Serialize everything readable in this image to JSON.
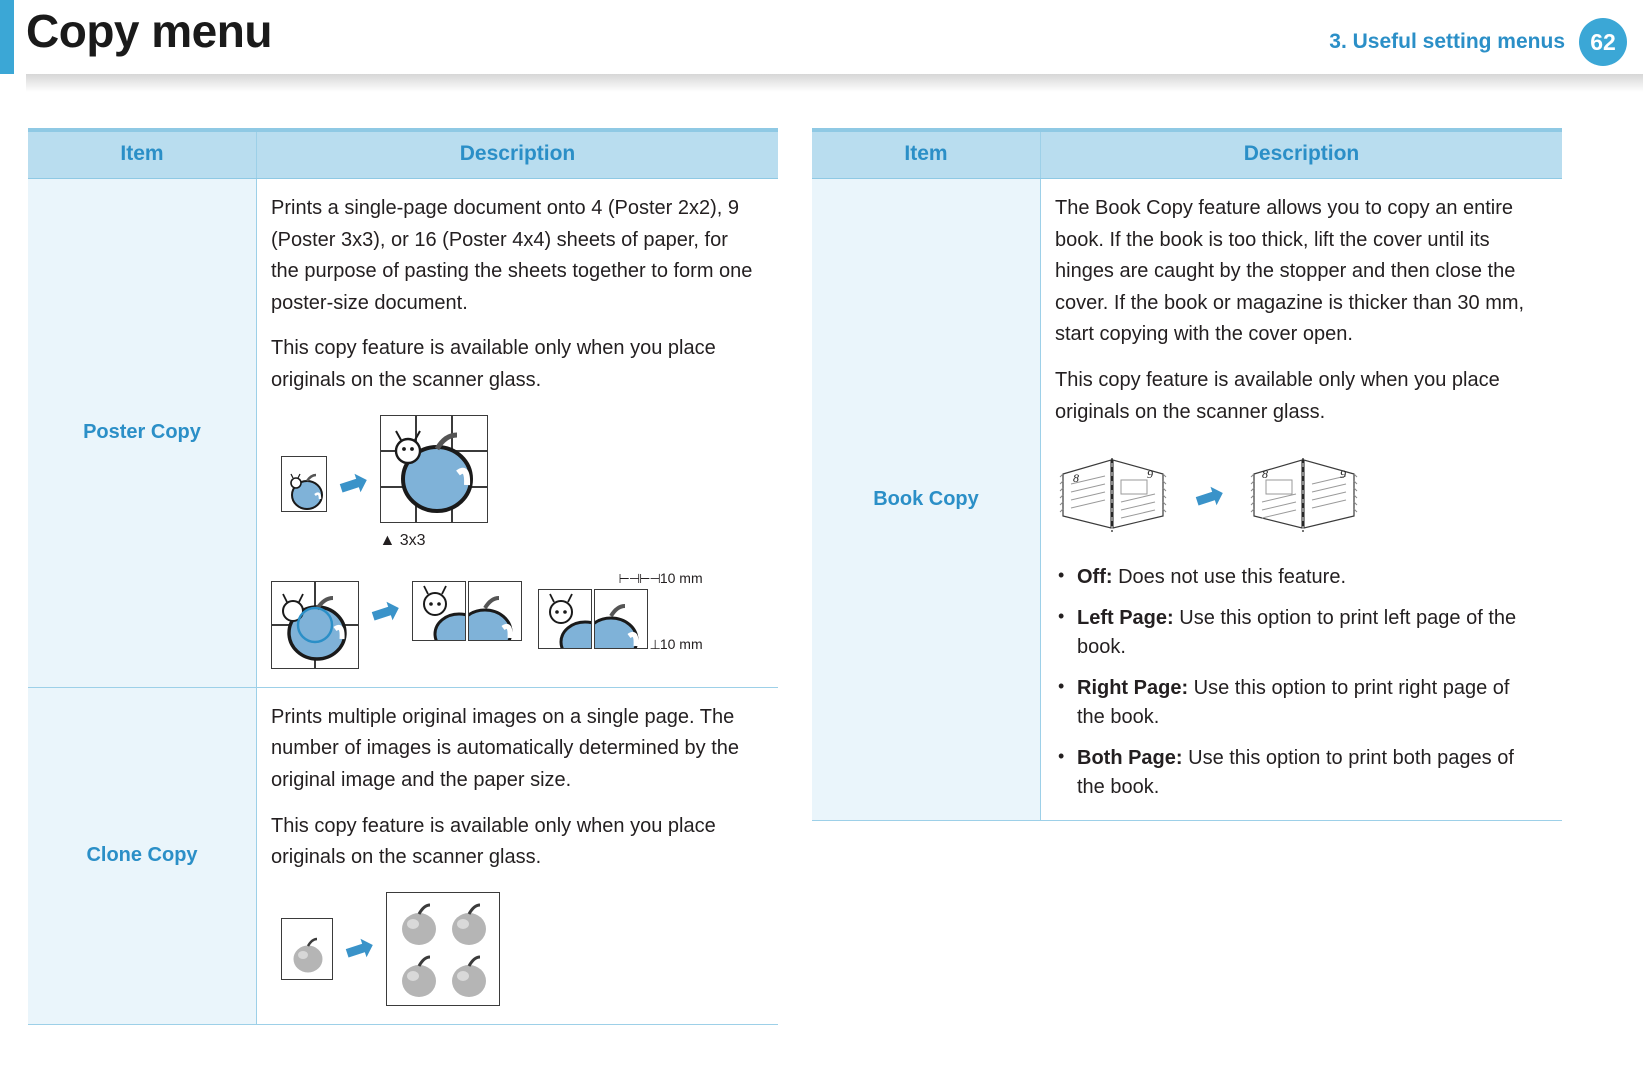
{
  "header": {
    "title": "Copy menu",
    "chapter": "3.  Useful setting menus",
    "page_number": "62",
    "accent_color": "#3ba7d6",
    "title_color": "#1a1a1a"
  },
  "table_headers": {
    "item": "Item",
    "description": "Description"
  },
  "left_column": {
    "rows": [
      {
        "item": "Poster Copy",
        "paragraphs": [
          "Prints a single-page document onto 4 (Poster 2x2), 9 (Poster 3x3), or 16 (Poster 4x4) sheets of paper, for the purpose of pasting the sheets together to form one poster-size document.",
          "This copy feature is available only when you place originals on the scanner glass."
        ],
        "figure": {
          "caption": "▲ 3x3",
          "margin_label_top": "10 mm",
          "margin_label_bottom": "10 mm",
          "arrow": "➡"
        }
      },
      {
        "item": "Clone Copy",
        "paragraphs": [
          "Prints multiple original images on a single page. The number of images is automatically determined by the original image and the paper size.",
          "This copy feature is available only when you place originals on the scanner glass."
        ],
        "figure": {
          "arrow": "➡"
        }
      }
    ]
  },
  "right_column": {
    "rows": [
      {
        "item": "Book Copy",
        "paragraphs": [
          "The Book Copy feature allows you to copy an entire book. If the book is too thick, lift the cover until its hinges are caught by the stopper and then close the cover. If the book or magazine is thicker than 30 mm, start copying with the cover open.",
          "This copy feature is available only when you place originals on the scanner glass."
        ],
        "figure": {
          "left_page_number": "8",
          "right_page_number": "9",
          "arrow": "➡"
        },
        "options": [
          {
            "term": "Off:",
            "text": " Does not use this feature."
          },
          {
            "term": "Left Page:",
            "text": " Use this option to print left page of the book."
          },
          {
            "term": "Right Page:",
            "text": " Use this option to print right page of the book."
          },
          {
            "term": "Both Page:",
            "text": " Use this option to print both pages of the book."
          }
        ]
      }
    ]
  },
  "colors": {
    "accent": "#3ba7d6",
    "table_header_bg": "#b9ddef",
    "item_cell_bg": "#eaf5fb",
    "heading_blue": "#2b8fc7",
    "body_text": "#231f20"
  }
}
